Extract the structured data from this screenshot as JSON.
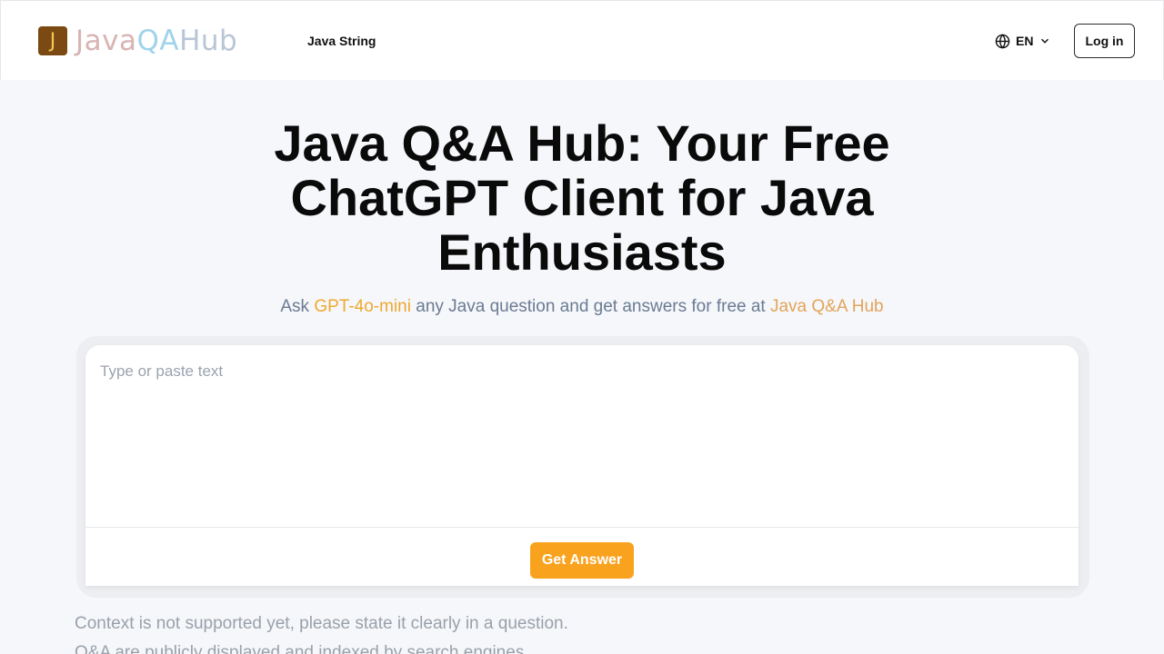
{
  "header": {
    "logo_letter": "J",
    "logo_java": "Java",
    "logo_qa": "QA",
    "logo_hub": "Hub",
    "nav_link": "Java String",
    "language": "EN",
    "login_label": "Log in"
  },
  "hero": {
    "title": "Java Q&A Hub: Your Free ChatGPT Client for Java Enthusiasts",
    "subtitle_prefix": "Ask ",
    "subtitle_model": "GPT-4o-mini",
    "subtitle_middle": " any Java question and get answers for free at ",
    "subtitle_site": "Java Q&A Hub"
  },
  "input": {
    "placeholder": "Type or paste text",
    "value": ""
  },
  "actions": {
    "get_answer_label": "Get Answer"
  },
  "notes": [
    "Context is not supported yet, please state it clearly in a question.",
    "Q&A are publicly displayed and indexed by search engines."
  ],
  "colors": {
    "accent": "#f9a21e",
    "highlight_model": "#f0a830",
    "highlight_site": "#e3a45a",
    "logo_badge": "#7a4a12",
    "page_background": "#f5f7fa"
  },
  "icons": {
    "language": "globe-icon",
    "dropdown": "chevron-down-icon"
  }
}
